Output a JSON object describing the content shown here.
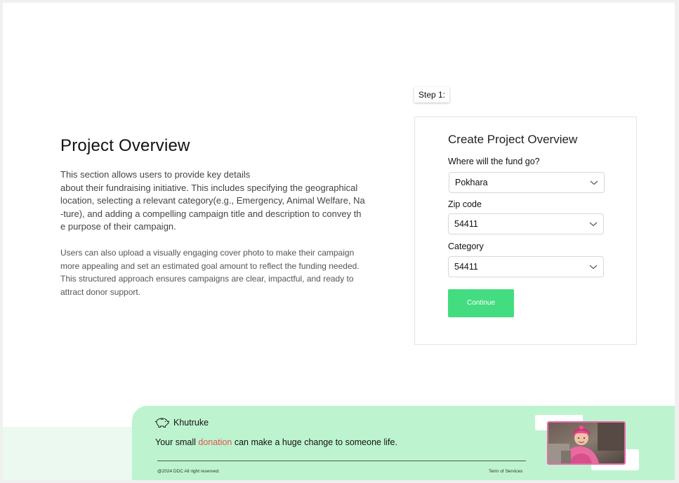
{
  "overview": {
    "title": "Project Overview",
    "para1_lines": [
      "This section allows users to provide key details",
      "about their fundraising initiative. This includes specifying the geographical",
      "location, selecting a relevant category(e.g., Emergency, Animal Welfare, Na",
      "-ture), and adding a compelling campaign title and description to convey th",
      "e purpose of their campaign."
    ],
    "para2_lines": [
      "Users can also upload a visually engaging cover photo to make their campaign",
      "more appealing and set an estimated goal amount to reflect the funding needed.",
      "This structured approach ensures campaigns are clear, impactful, and ready to",
      "attract donor support."
    ]
  },
  "step_label": "Step 1:",
  "form": {
    "title": "Create Project Overview",
    "fund_label": "Where will the fund go?",
    "fund_value": "Pokhara",
    "zip_label": "Zip code",
    "zip_value": "54411",
    "category_label": "Category",
    "category_value": "54411",
    "continue_label": "Continue"
  },
  "footer": {
    "brand": "Khutruke",
    "tagline_before": "Your small ",
    "tagline_highlight": "donation",
    "tagline_after": " can make a huge change to someone life.",
    "copyright": "@2024 DDC All right reserved.",
    "terms": "Term of Services"
  },
  "colors": {
    "accent_button": "#44dc80",
    "footer_bg": "#bdf4cf",
    "highlight_text": "#e2524f",
    "photo_border": "#e86aa8"
  },
  "icons": {
    "brand": "piggy-bank-icon",
    "dropdown": "chevron-down-icon"
  }
}
